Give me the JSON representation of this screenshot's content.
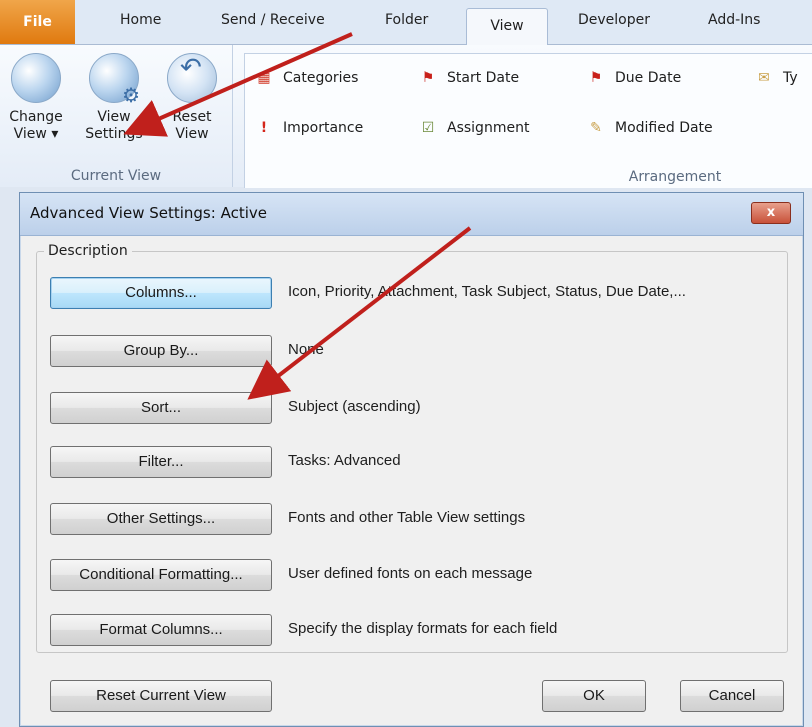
{
  "ribbon_tabs": [
    "File",
    "Home",
    "Send / Receive",
    "Folder",
    "View",
    "Developer",
    "Add-Ins"
  ],
  "current_view_group": {
    "label": "Current View",
    "buttons": [
      {
        "line1": "Change",
        "line2": "View ▾"
      },
      {
        "line1": "View",
        "line2": "Settings"
      },
      {
        "line1": "Reset",
        "line2": "View"
      }
    ]
  },
  "arrangement_group": {
    "label": "Arrangement",
    "items": [
      "Categories",
      "Start Date",
      "Due Date",
      "Ty",
      "Importance",
      "Assignment",
      "Modified Date"
    ]
  },
  "dialog": {
    "title": "Advanced View Settings: Active",
    "close_label": "x",
    "section_label": "Description",
    "rows": [
      {
        "button": "Columns...",
        "desc": "Icon, Priority, Attachment, Task Subject, Status, Due Date,..."
      },
      {
        "button": "Group By...",
        "desc": "None"
      },
      {
        "button": "Sort...",
        "desc": "Subject (ascending)"
      },
      {
        "button": "Filter...",
        "desc": "Tasks: Advanced"
      },
      {
        "button": "Other Settings...",
        "desc": "Fonts and other Table View settings"
      },
      {
        "button": "Conditional Formatting...",
        "desc": "User defined fonts on each message"
      },
      {
        "button": "Format Columns...",
        "desc": "Specify the display formats for each field"
      }
    ],
    "reset_label": "Reset Current View",
    "ok_label": "OK",
    "cancel_label": "Cancel"
  },
  "colors": {
    "file_tab": "#e07a0f",
    "arrow": "#c0201c",
    "title_bar": "#bcd0ea"
  }
}
